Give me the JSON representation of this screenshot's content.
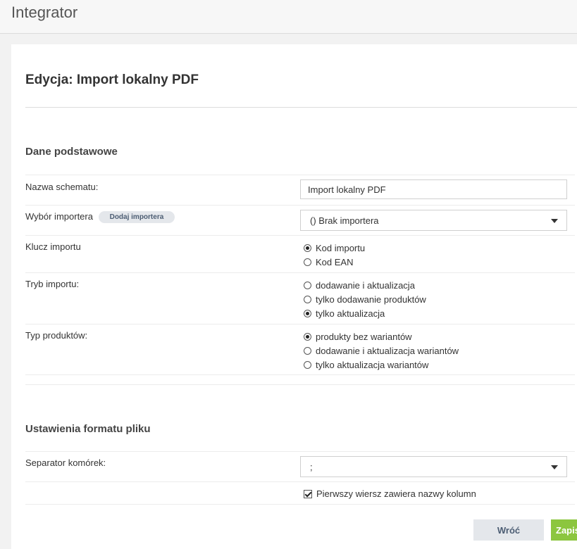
{
  "app": {
    "title": "Integrator"
  },
  "page": {
    "title": "Edycja: Import lokalny PDF"
  },
  "basic": {
    "section_title": "Dane podstawowe",
    "schema_name": {
      "label": "Nazwa schematu:",
      "value": "Import lokalny PDF"
    },
    "importer": {
      "label": "Wybór importera",
      "add_label": "Dodaj importera",
      "selected": "() Brak importera"
    },
    "import_key": {
      "label": "Klucz importu",
      "options": [
        {
          "label": "Kod importu",
          "checked": true
        },
        {
          "label": "Kod EAN",
          "checked": false
        }
      ]
    },
    "import_mode": {
      "label": "Tryb importu:",
      "options": [
        {
          "label": "dodawanie i aktualizacja",
          "checked": false
        },
        {
          "label": "tylko dodawanie produktów",
          "checked": false
        },
        {
          "label": "tylko aktualizacja",
          "checked": true
        }
      ]
    },
    "product_type": {
      "label": "Typ produktów:",
      "options": [
        {
          "label": "produkty bez wariantów",
          "checked": true
        },
        {
          "label": "dodawanie i aktualizacja wariantów",
          "checked": false
        },
        {
          "label": "tylko aktualizacja wariantów",
          "checked": false
        }
      ]
    }
  },
  "file_format": {
    "section_title": "Ustawienia formatu pliku",
    "separator": {
      "label": "Separator komórek:",
      "selected": ";"
    },
    "header_row": {
      "label": "Pierwszy wiersz zawiera nazwy kolumn",
      "checked": true
    }
  },
  "actions": {
    "back": "Wróć",
    "save": "Zapisz"
  }
}
